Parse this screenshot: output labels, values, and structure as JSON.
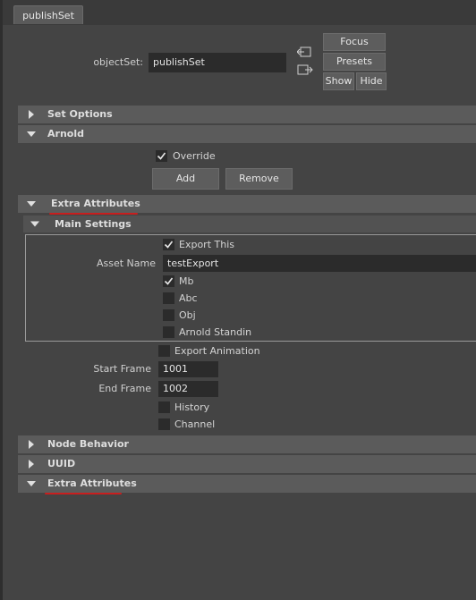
{
  "tab": {
    "label": "publishSet"
  },
  "object_set": {
    "label": "objectSet:",
    "value": "publishSet"
  },
  "side_buttons": {
    "focus": "Focus",
    "presets": "Presets",
    "show": "Show",
    "hide": "Hide"
  },
  "sections": {
    "set_options": "Set Options",
    "arnold": "Arnold",
    "extra_attributes": "Extra Attributes",
    "main_settings": "Main Settings",
    "node_behavior": "Node Behavior",
    "uuid": "UUID",
    "extra_attributes_2": "Extra Attributes"
  },
  "arnold": {
    "override": {
      "label": "Override",
      "checked": true
    },
    "add": "Add",
    "remove": "Remove"
  },
  "main_settings": {
    "export_this": {
      "label": "Export This",
      "checked": true
    },
    "asset_name_label": "Asset Name",
    "asset_name_value": "testExport",
    "mb": {
      "label": "Mb",
      "checked": true
    },
    "abc": {
      "label": "Abc",
      "checked": false
    },
    "obj": {
      "label": "Obj",
      "checked": false
    },
    "arnold_standin": {
      "label": "Arnold Standin",
      "checked": false
    }
  },
  "extra": {
    "export_animation": {
      "label": "Export Animation",
      "checked": false
    },
    "start_frame_label": "Start Frame",
    "start_frame_value": "1001",
    "end_frame_label": "End Frame",
    "end_frame_value": "1002",
    "history": {
      "label": "History",
      "checked": false
    },
    "channel": {
      "label": "Channel",
      "checked": false
    }
  },
  "colors": {
    "panel": "#444444",
    "section": "#5b5b5b",
    "field": "#2b2b2b",
    "annotation": "#c81e1e"
  }
}
